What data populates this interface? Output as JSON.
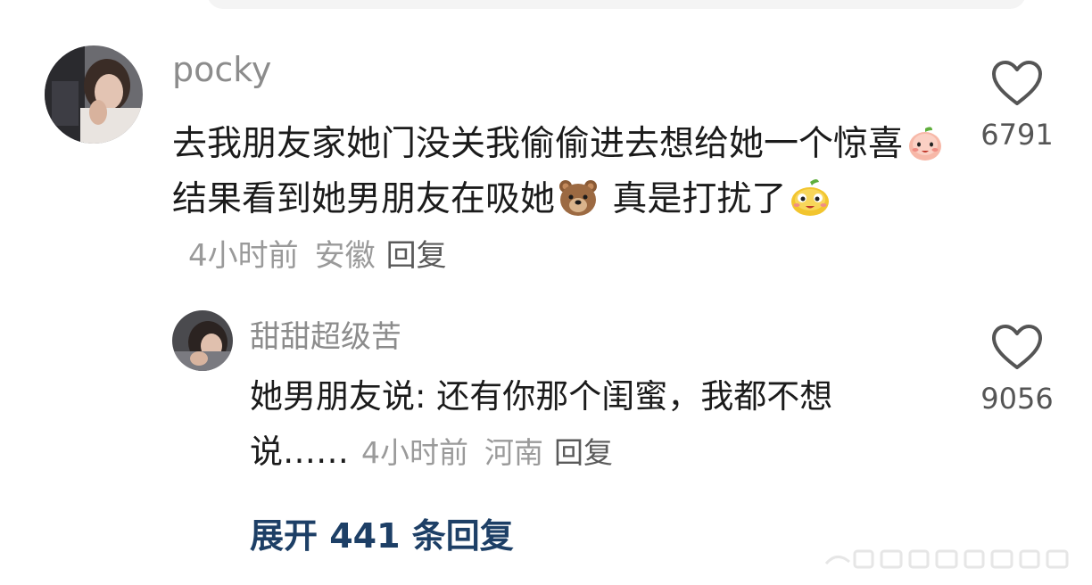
{
  "comment": {
    "username": "pocky",
    "text_part1": "去我朋友家她门没关我偷偷进去想给她一个惊喜",
    "emoji1": "peach-face-emoji",
    "text_part2": "结果看到她男朋友在吸她",
    "emoji2": "bear-face-emoji",
    "text_part3": " 真是打扰了",
    "emoji3": "yellow-blob-emoji",
    "time": "4小时前",
    "location": "安徽",
    "reply_label": "回复",
    "like_count": "6791"
  },
  "reply": {
    "username": "甜甜超级苦",
    "text": "她男朋友说: 还有你那个闺蜜，我都不想说……",
    "time": "4小时前",
    "location": "河南",
    "reply_label": "回复",
    "like_count": "9056"
  },
  "expand_label": "展开 441 条回复",
  "colors": {
    "username": "#8c8c8c",
    "meta": "#9a9a9a",
    "expand": "#1d3f66",
    "heart_outline": "#555555"
  }
}
